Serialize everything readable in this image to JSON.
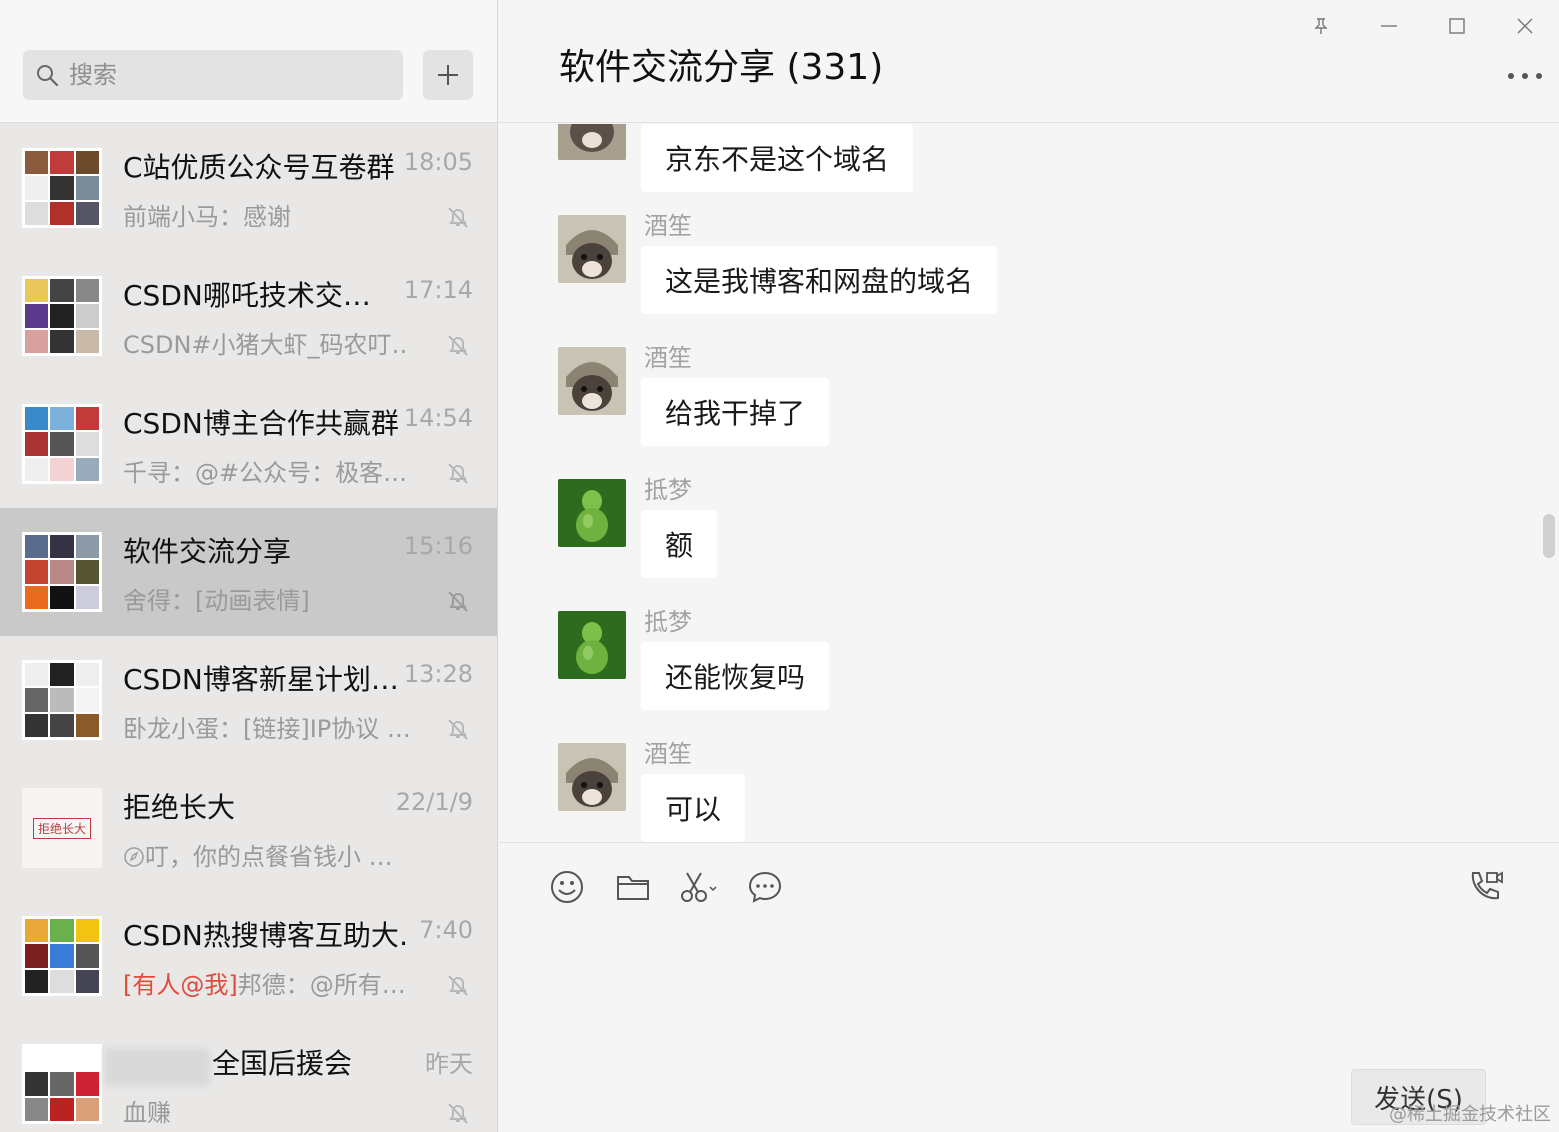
{
  "search": {
    "placeholder": "搜索"
  },
  "chats": [
    {
      "name": "C站优质公众号互卷群",
      "time": "18:05",
      "preview": "前端小马：感谢",
      "mention": ""
    },
    {
      "name": "CSDN哪吒技术交…",
      "time": "17:14",
      "preview": "CSDN#小猪大虾_码农叮…",
      "mention": ""
    },
    {
      "name": "CSDN博主合作共赢群",
      "time": "14:54",
      "preview": "千寻：@#公众号：极客…",
      "mention": ""
    },
    {
      "name": "软件交流分享",
      "time": "15:16",
      "preview": "舍得：[动画表情]",
      "mention": ""
    },
    {
      "name": "CSDN博客新星计划…",
      "time": "13:28",
      "preview": "卧龙小蛋：[链接]IP协议 …",
      "mention": ""
    },
    {
      "name": "拒绝长大",
      "time": "22/1/9",
      "preview": "叮，你的点餐省钱小 …",
      "mention": "",
      "avatar_text": "拒绝长大"
    },
    {
      "name": "CSDN热搜博客互助大…",
      "time": "7:40",
      "preview": "邦德：@所有…",
      "mention": "[有人@我]"
    },
    {
      "name": "全国后援会",
      "time": "昨天",
      "preview": "血赚",
      "mention": ""
    }
  ],
  "header": {
    "title": "软件交流分享 (331)"
  },
  "messages": [
    {
      "sender": "",
      "text": "京东不是这个域名",
      "avatar": "dog"
    },
    {
      "sender": "酒笙",
      "text": "这是我博客和网盘的域名",
      "avatar": "dog"
    },
    {
      "sender": "酒笙",
      "text": "给我干掉了",
      "avatar": "dog"
    },
    {
      "sender": "抵梦",
      "text": "额",
      "avatar": "gourd"
    },
    {
      "sender": "抵梦",
      "text": "还能恢复吗",
      "avatar": "gourd"
    },
    {
      "sender": "酒笙",
      "text": "可以",
      "avatar": "dog"
    }
  ],
  "composer": {
    "send_label": "发送(S)"
  },
  "watermark": "@稀土掘金技术社区",
  "colors": {
    "selected": "#c9c9c9",
    "mention": "#e14b3b",
    "sidebar_bg": "#e9e8e7",
    "main_bg": "#f5f5f5"
  }
}
